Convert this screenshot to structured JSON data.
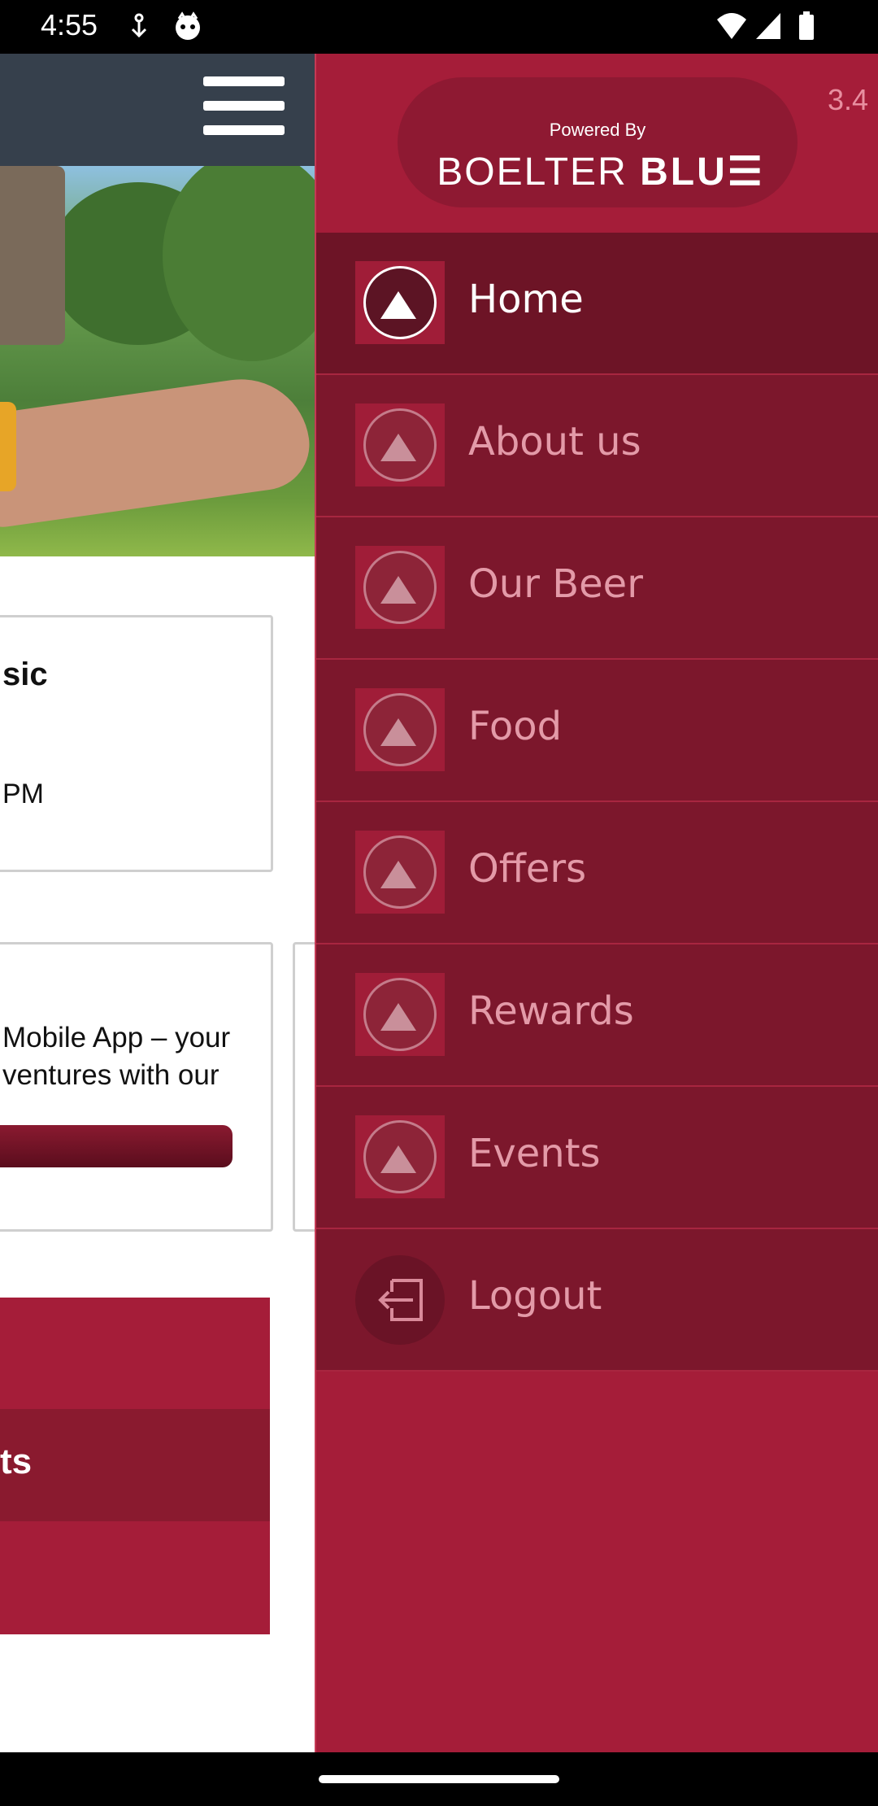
{
  "status_bar": {
    "time": "4:55",
    "icons": [
      "download-icon",
      "cat-icon",
      "wifi-icon",
      "signal-icon",
      "battery-icon"
    ]
  },
  "background_page": {
    "card1": {
      "heading": "sic",
      "text": "PM"
    },
    "card2": {
      "line1": "Mobile App – your",
      "line2": "ventures with our"
    },
    "promo": {
      "text": "ts"
    }
  },
  "drawer": {
    "version": "3.4",
    "powered_by": "Powered By",
    "brand_light": "BOELTER",
    "brand_bold": "BLU☰",
    "items": [
      {
        "label": "Home",
        "active": true
      },
      {
        "label": "About us",
        "active": false
      },
      {
        "label": "Our Beer",
        "active": false
      },
      {
        "label": "Food",
        "active": false
      },
      {
        "label": "Offers",
        "active": false
      },
      {
        "label": "Rewards",
        "active": false
      },
      {
        "label": "Events",
        "active": false
      },
      {
        "label": "Logout",
        "active": false,
        "icon": "logout-icon"
      }
    ]
  },
  "colors": {
    "drawer_bg": "#a51d39",
    "menu_item_bg": "#7c172c",
    "header_bg": "#36404c"
  }
}
